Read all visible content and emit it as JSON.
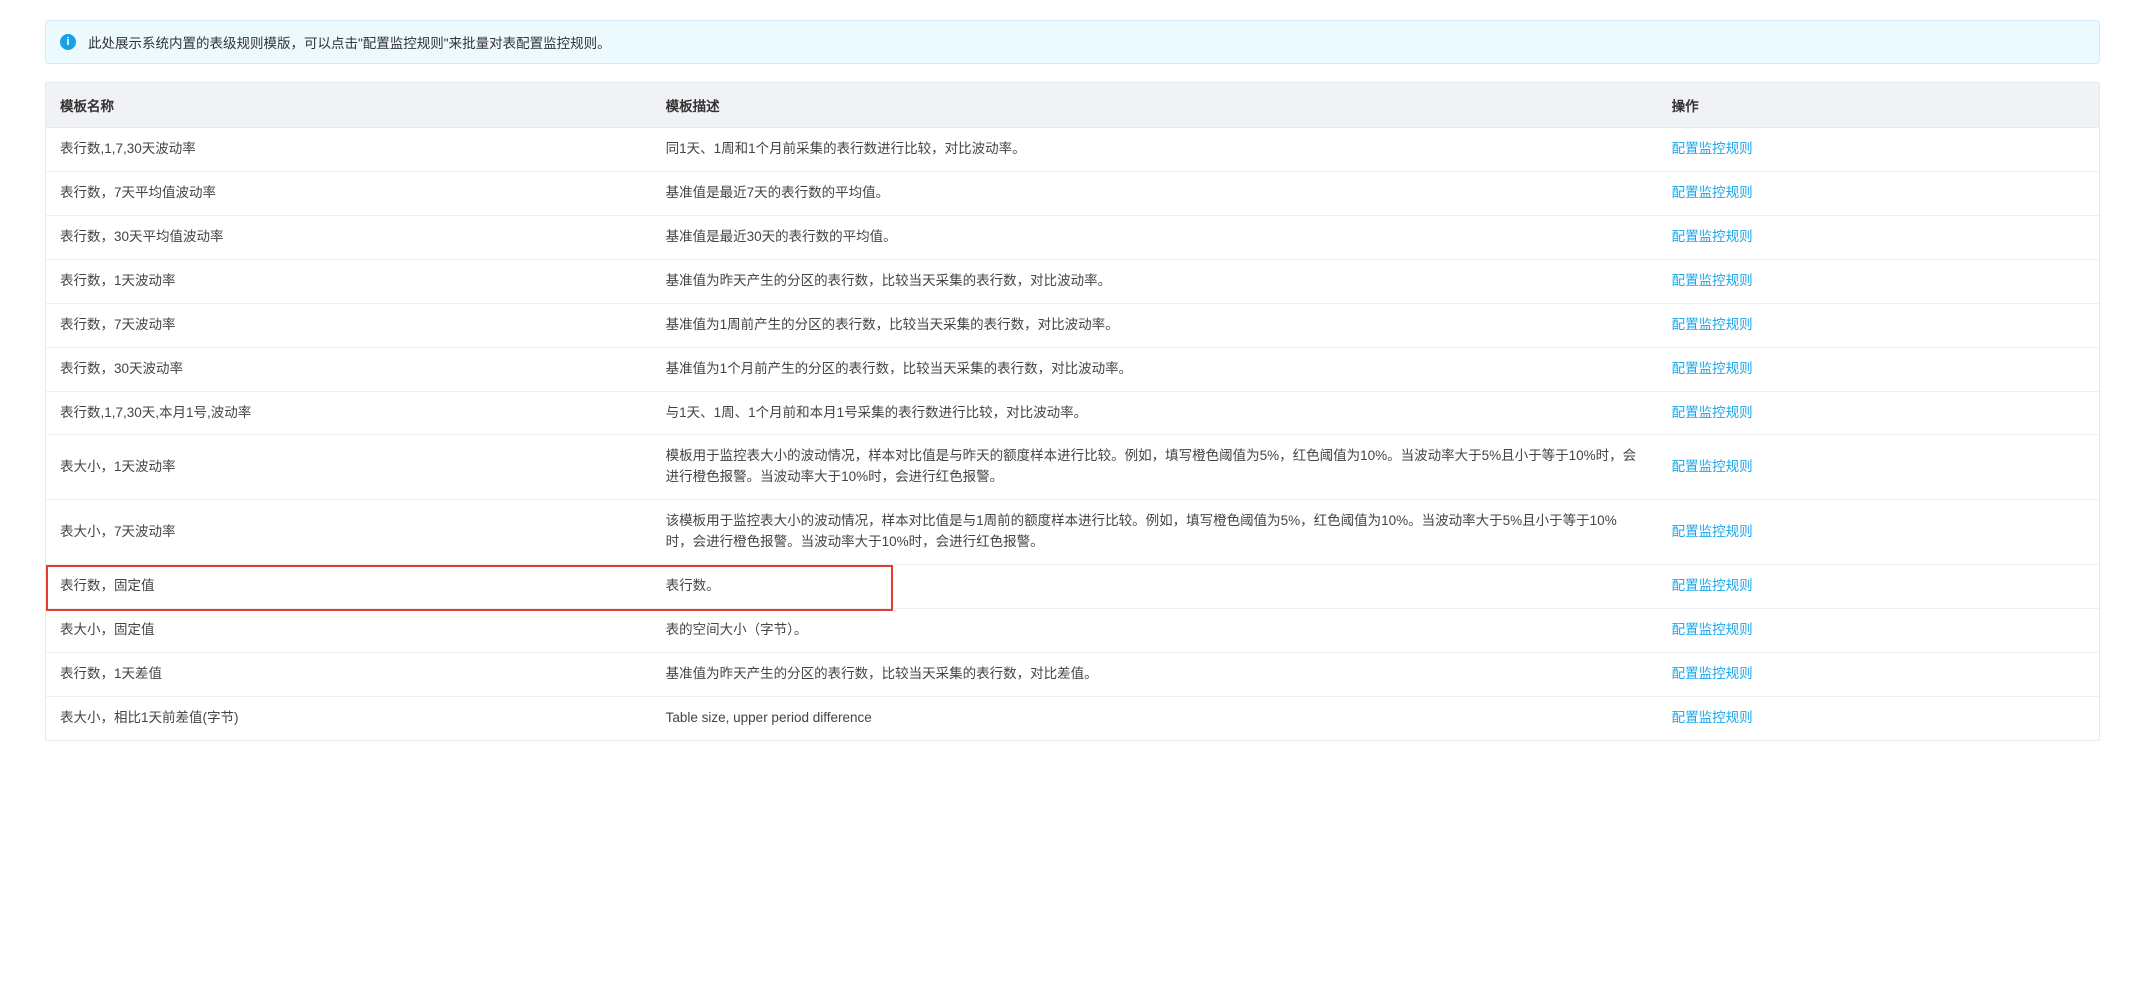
{
  "banner": {
    "text": "此处展示系统内置的表级规则模版，可以点击\"配置监控规则\"来批量对表配置监控规则。"
  },
  "table": {
    "headers": {
      "name": "模板名称",
      "desc": "模板描述",
      "action": "操作"
    },
    "action_label": "配置监控规则",
    "rows": [
      {
        "name": "表行数,1,7,30天波动率",
        "desc": "同1天、1周和1个月前采集的表行数进行比较，对比波动率。"
      },
      {
        "name": "表行数，7天平均值波动率",
        "desc": "基准值是最近7天的表行数的平均值。"
      },
      {
        "name": "表行数，30天平均值波动率",
        "desc": "基准值是最近30天的表行数的平均值。"
      },
      {
        "name": "表行数，1天波动率",
        "desc": "基准值为昨天产生的分区的表行数，比较当天采集的表行数，对比波动率。"
      },
      {
        "name": "表行数，7天波动率",
        "desc": "基准值为1周前产生的分区的表行数，比较当天采集的表行数，对比波动率。"
      },
      {
        "name": "表行数，30天波动率",
        "desc": "基准值为1个月前产生的分区的表行数，比较当天采集的表行数，对比波动率。"
      },
      {
        "name": "表行数,1,7,30天,本月1号,波动率",
        "desc": "与1天、1周、1个月前和本月1号采集的表行数进行比较，对比波动率。"
      },
      {
        "name": "表大小，1天波动率",
        "desc": "模板用于监控表大小的波动情况，样本对比值是与昨天的额度样本进行比较。例如，填写橙色阈值为5%，红色阈值为10%。当波动率大于5%且小于等于10%时，会进行橙色报警。当波动率大于10%时，会进行红色报警。"
      },
      {
        "name": "表大小，7天波动率",
        "desc": "该模板用于监控表大小的波动情况，样本对比值是与1周前的额度样本进行比较。例如，填写橙色阈值为5%，红色阈值为10%。当波动率大于5%且小于等于10%时，会进行橙色报警。当波动率大于10%时，会进行红色报警。"
      },
      {
        "name": "表行数，固定值",
        "desc": "表行数。"
      },
      {
        "name": "表大小，固定值",
        "desc": "表的空间大小（字节）。"
      },
      {
        "name": "表行数，1天差值",
        "desc": "基准值为昨天产生的分区的表行数，比较当天采集的表行数，对比差值。"
      },
      {
        "name": "表大小，相比1天前差值(字节)",
        "desc": "Table size, upper period difference"
      }
    ]
  },
  "highlight_row_index": 9
}
